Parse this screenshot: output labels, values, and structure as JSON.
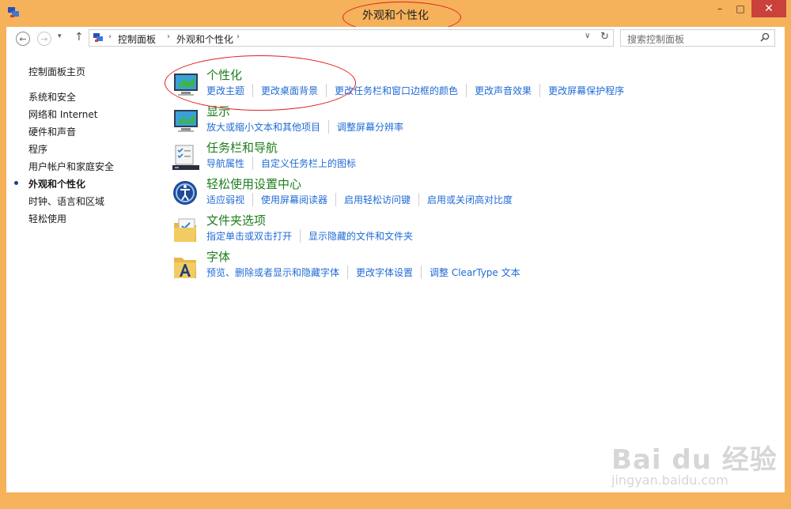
{
  "window": {
    "title": "外观和个性化",
    "minimize_glyph": "–",
    "maximize_glyph": "□",
    "close_glyph": "✕"
  },
  "nav": {
    "back_glyph": "←",
    "forward_glyph": "→",
    "recent_glyph": "▾",
    "up_glyph": "↑",
    "breadcrumb": [
      "控制面板",
      "外观和个性化"
    ],
    "dropdown_glyph": "∨",
    "refresh_glyph": "↻",
    "search_placeholder": "搜索控制面板"
  },
  "sidebar": {
    "home": "控制面板主页",
    "items": [
      {
        "label": "系统和安全"
      },
      {
        "label": "网络和 Internet"
      },
      {
        "label": "硬件和声音"
      },
      {
        "label": "程序"
      },
      {
        "label": "用户帐户和家庭安全"
      },
      {
        "label": "外观和个性化",
        "active": true
      },
      {
        "label": "时钟、语言和区域"
      },
      {
        "label": "轻松使用"
      }
    ]
  },
  "categories": [
    {
      "title": "个性化",
      "icon": "personalization-icon",
      "links": [
        "更改主题",
        "更改桌面背景",
        "更改任务栏和窗口边框的颜色",
        "更改声音效果",
        "更改屏幕保护程序"
      ]
    },
    {
      "title": "显示",
      "icon": "display-icon",
      "links": [
        "放大或缩小文本和其他项目",
        "调整屏幕分辨率"
      ]
    },
    {
      "title": "任务栏和导航",
      "icon": "taskbar-icon",
      "links": [
        "导航属性",
        "自定义任务栏上的图标"
      ]
    },
    {
      "title": "轻松使用设置中心",
      "icon": "ease-of-access-icon",
      "links": [
        "适应弱视",
        "使用屏幕阅读器",
        "启用轻松访问键",
        "启用或关闭高对比度"
      ]
    },
    {
      "title": "文件夹选项",
      "icon": "folder-options-icon",
      "links": [
        "指定单击或双击打开",
        "显示隐藏的文件和文件夹"
      ]
    },
    {
      "title": "字体",
      "icon": "fonts-icon",
      "links": [
        "预览、删除或者显示和隐藏字体",
        "更改字体设置",
        "调整 ClearType 文本"
      ]
    }
  ],
  "watermark": {
    "logo": "Bai du 经验",
    "url": "jingyan.baidu.com"
  },
  "colors": {
    "frame": "#f6b15b",
    "link": "#1f6bd6",
    "category_title": "#1e7d1e",
    "close_button": "#c9413a",
    "annotation": "#e02020"
  }
}
